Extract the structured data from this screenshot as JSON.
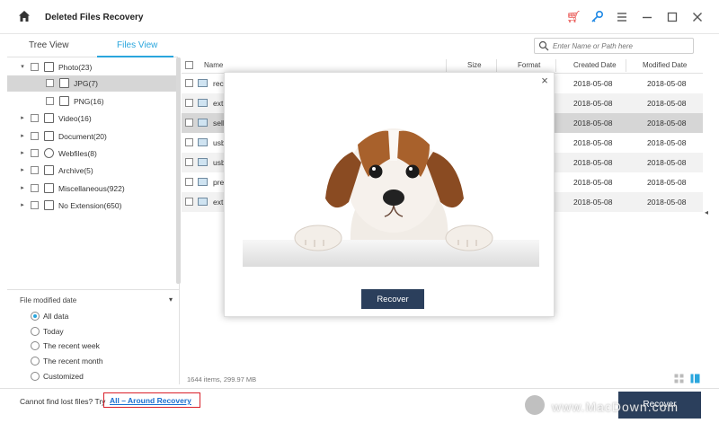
{
  "app": {
    "title": "Deleted Files Recovery"
  },
  "icons": [
    "home-icon",
    "cart-icon",
    "key-icon",
    "menu-icon",
    "minimize-icon",
    "maximize-icon",
    "close-icon",
    "search-icon",
    "grid-view-icon",
    "list-view-icon"
  ],
  "colors": {
    "accent": "#2aa6dd",
    "button": "#2b3f5c",
    "highlight_box": "#d9202a",
    "link": "#1a6fd0"
  },
  "tabs": {
    "tree": "Tree View",
    "files": "Files View"
  },
  "search": {
    "placeholder": "Enter Name or Path here"
  },
  "tree": [
    {
      "label": "Photo(23)",
      "expanded": true
    },
    {
      "label": "JPG(7)",
      "selected": true
    },
    {
      "label": "PNG(16)"
    },
    {
      "label": "Video(16)"
    },
    {
      "label": "Document(20)"
    },
    {
      "label": "Webfiles(8)"
    },
    {
      "label": "Archive(5)"
    },
    {
      "label": "Miscellaneous(922)"
    },
    {
      "label": "No Extension(650)"
    }
  ],
  "filter": {
    "title": "File modified date",
    "options": [
      "All data",
      "Today",
      "The recent week",
      "The recent month",
      "Customized"
    ],
    "selected": "All data"
  },
  "list": {
    "columns": {
      "name": "Name",
      "size": "Size",
      "format": "Format",
      "created": "Created Date",
      "modified": "Modified Date"
    },
    "rows": [
      {
        "name": "rec",
        "created": "2018-05-08",
        "modified": "2018-05-08"
      },
      {
        "name": "ext",
        "created": "2018-05-08",
        "modified": "2018-05-08"
      },
      {
        "name": "sell",
        "created": "2018-05-08",
        "modified": "2018-05-08"
      },
      {
        "name": "usb",
        "created": "2018-05-08",
        "modified": "2018-05-08"
      },
      {
        "name": "usb",
        "created": "2018-05-08",
        "modified": "2018-05-08"
      },
      {
        "name": "pre",
        "created": "2018-05-08",
        "modified": "2018-05-08"
      },
      {
        "name": "ext",
        "created": "2018-05-08",
        "modified": "2018-05-08"
      }
    ]
  },
  "status": {
    "summary": "1644 items, 299.97 MB"
  },
  "footer": {
    "prompt": "Cannot find lost files? Try",
    "link": "All – Around Recovery",
    "recover": "Recover"
  },
  "dialog": {
    "recover": "Recover",
    "close": "×"
  },
  "watermark": {
    "text": "www.MacDown.com"
  }
}
